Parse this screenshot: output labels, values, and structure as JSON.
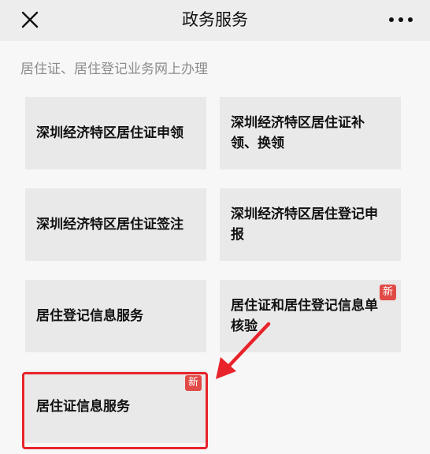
{
  "header": {
    "title": "政务服务"
  },
  "section": {
    "title": "居住证、居住登记业务网上办理"
  },
  "tiles": [
    {
      "label": "深圳经济特区居住证申领"
    },
    {
      "label": "深圳经济特区居住证补领、换领"
    },
    {
      "label": "深圳经济特区居住证签注"
    },
    {
      "label": "深圳经济特区居住登记申报"
    },
    {
      "label": "居住登记信息服务"
    },
    {
      "label": "居住证和居住登记信息单核验",
      "badge": "新"
    },
    {
      "label": "居住证信息服务",
      "badge": "新"
    }
  ],
  "colors": {
    "accent_red": "#e8232a",
    "badge_red": "#e24a47",
    "tile_bg": "#e9e9e9",
    "header_bg": "#ededed"
  },
  "icons": {
    "close": "close-icon",
    "more": "more-dots-icon",
    "annotation": "red-arrow-icon"
  }
}
